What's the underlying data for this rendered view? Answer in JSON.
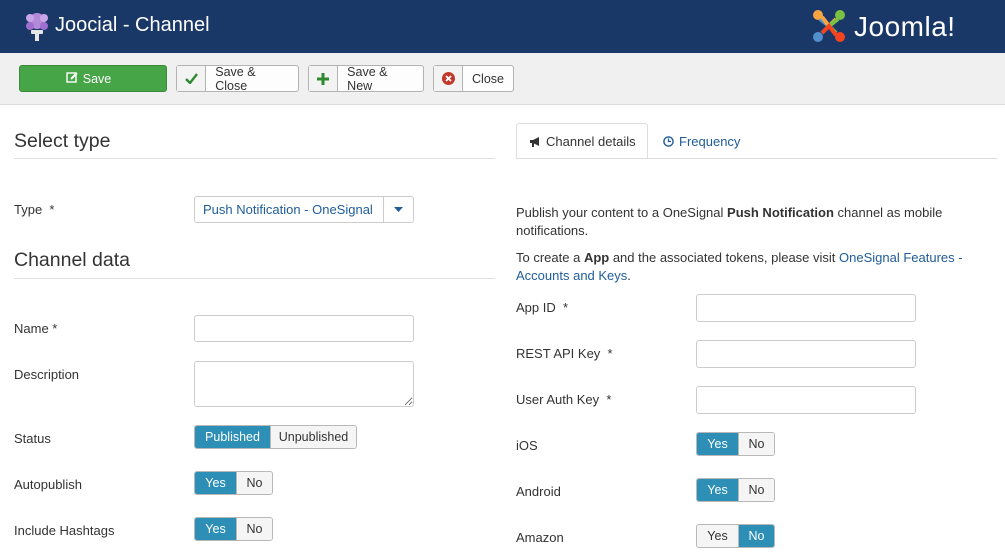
{
  "header": {
    "title": "Joocial - Channel",
    "brand": "Joomla!"
  },
  "toolbar": {
    "save_label": "Save",
    "save_close_label": "Save & Close",
    "save_new_label": "Save & New",
    "close_label": "Close"
  },
  "left": {
    "select_type_title": "Select type",
    "type_label": "Type  *",
    "type_value": "Push Notification - OneSignal",
    "channel_data_title": "Channel data",
    "name_label": "Name *",
    "name_value": "",
    "description_label": "Description",
    "description_value": "",
    "status_label": "Status",
    "status_options": [
      "Published",
      "Unpublished"
    ],
    "status_selected": "Published",
    "autopublish_label": "Autopublish",
    "autopublish_options": [
      "Yes",
      "No"
    ],
    "autopublish_selected": "Yes",
    "hashtags_label": "Include Hashtags",
    "hashtags_options": [
      "Yes",
      "No"
    ],
    "hashtags_selected": "Yes"
  },
  "right": {
    "tabs": [
      {
        "label": "Channel details",
        "active": true
      },
      {
        "label": "Frequency",
        "active": false
      }
    ],
    "intro_pre": "Publish your content to a OneSignal ",
    "intro_bold": "Push Notification",
    "intro_post": " channel as mobile notifications.",
    "create_pre": "To create a ",
    "create_bold": "App",
    "create_mid": " and the associated tokens, please visit ",
    "create_link": "OneSignal Features - Accounts and Keys",
    "create_post": ".",
    "app_id_label": "App ID  *",
    "app_id_value": "",
    "rest_api_label": "REST API Key  *",
    "rest_api_value": "",
    "user_auth_label": "User Auth Key  *",
    "user_auth_value": "",
    "ios_label": "iOS",
    "ios_options": [
      "Yes",
      "No"
    ],
    "ios_selected": "Yes",
    "android_label": "Android",
    "android_options": [
      "Yes",
      "No"
    ],
    "android_selected": "Yes",
    "amazon_label": "Amazon",
    "amazon_options": [
      "Yes",
      "No"
    ],
    "amazon_selected": "No"
  },
  "colors": {
    "header_bg": "#1a3867",
    "save_green": "#46a546",
    "toggle_active": "#2d8fb5",
    "link": "#1f5c99"
  },
  "icons": {
    "app_logo": "joocial-logo-icon",
    "brand_logo": "joomla-logo-icon",
    "save": "edit-icon",
    "save_close": "check-icon",
    "save_new": "plus-icon",
    "close": "cancel-icon",
    "select_arrow": "caret-down-icon",
    "tab_details": "bullhorn-icon",
    "tab_frequency": "clock-icon"
  }
}
